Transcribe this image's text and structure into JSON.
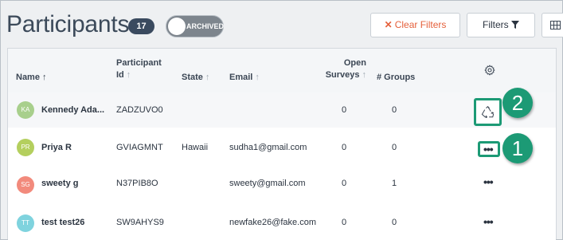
{
  "header": {
    "title": "Participants",
    "count": "17",
    "archived_label": "ARCHIVED",
    "clear_filters_label": "Clear Filters",
    "filters_label": "Filters"
  },
  "table": {
    "columns": {
      "name": "Name",
      "participant_id_line1": "Participant",
      "participant_id_line2": "Id",
      "state": "State",
      "email": "Email",
      "open_surveys_line1": "Open",
      "open_surveys_line2": "Surveys",
      "groups": "# Groups"
    },
    "rows": [
      {
        "initials": "KA",
        "name": "Kennedy Ada...",
        "participant_id": "ZADZUVO0",
        "state": "",
        "email": "",
        "open_surveys": "0",
        "groups": "0",
        "avatar_color": "#a8cf8c"
      },
      {
        "initials": "PR",
        "name": "Priya R",
        "participant_id": "GVIAGMNT",
        "state": "Hawaii",
        "email": "sudha1@gmail.com",
        "open_surveys": "0",
        "groups": "0",
        "avatar_color": "#b4cf5e"
      },
      {
        "initials": "SG",
        "name": "sweety g",
        "participant_id": "N37PIB8O",
        "state": "",
        "email": "sweety@gmail.com",
        "open_surveys": "0",
        "groups": "1",
        "avatar_color": "#f28a7c"
      },
      {
        "initials": "TT",
        "name": "test test26",
        "participant_id": "SW9AHYS9",
        "state": "",
        "email": "newfake26@fake.com",
        "open_surveys": "0",
        "groups": "0",
        "avatar_color": "#7fd3de"
      }
    ]
  },
  "callouts": {
    "step1": "1",
    "step2": "2"
  },
  "colors": {
    "accent_green": "#1c9a75",
    "clear_filters_text": "#e5603b",
    "badge_bg": "#3a4a5f"
  },
  "icons": {
    "recycle": "recycle-icon",
    "more": "more-dots-icon",
    "settings": "gear-icon",
    "filter": "filter-funnel-icon",
    "columns": "grid-icon"
  }
}
